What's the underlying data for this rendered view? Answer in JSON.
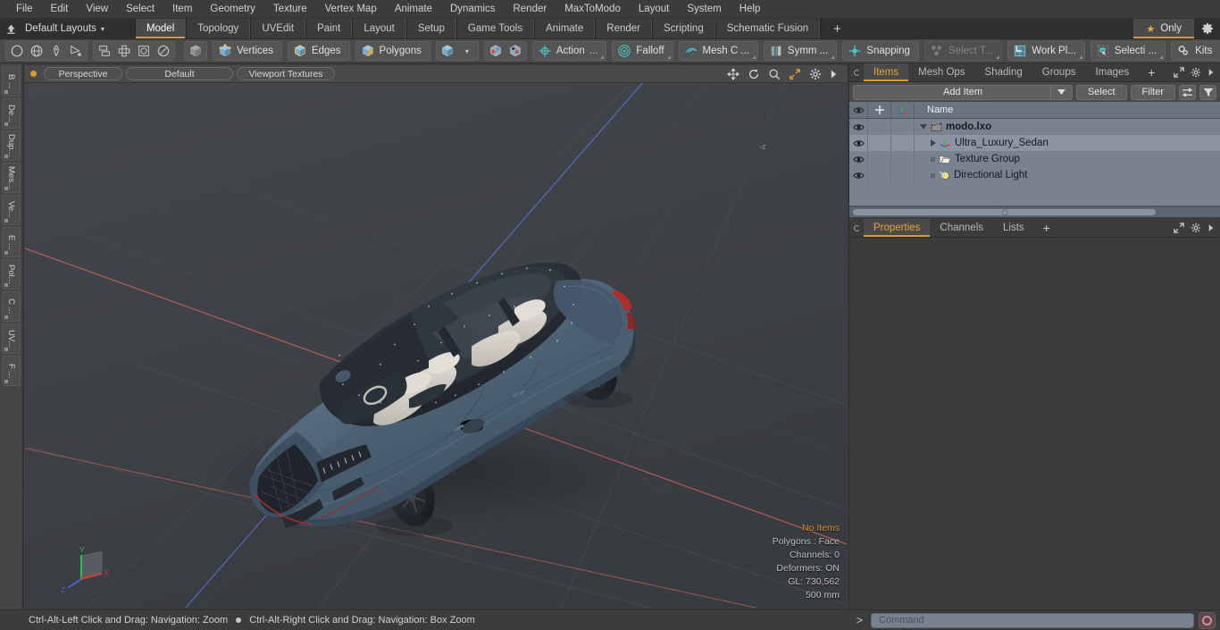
{
  "menubar": {
    "items": [
      "File",
      "Edit",
      "View",
      "Select",
      "Item",
      "Geometry",
      "Texture",
      "Vertex Map",
      "Animate",
      "Dynamics",
      "Render",
      "MaxToModo",
      "Layout",
      "System",
      "Help"
    ]
  },
  "layoutbar": {
    "home_icon": "home-arrow-icon",
    "layouts_label": "Default Layouts",
    "caret": "▾",
    "tabs": [
      "Model",
      "Topology",
      "UVEdit",
      "Paint",
      "Layout",
      "Setup",
      "Game Tools",
      "Animate",
      "Render",
      "Scripting",
      "Schematic Fusion"
    ],
    "active_tab": "Model",
    "add_tab_label": "+",
    "only_label": "Only",
    "star_glyph": "★",
    "gear_icon": "gear-icon",
    "accent_color": "#d79a35"
  },
  "toolbar": {
    "shape_tools": [
      "circle-icon",
      "globe-icon",
      "pen-icon",
      "curve-icon"
    ],
    "mesh_tools": [
      "stack-icon",
      "array-icon",
      "boolean-icon",
      "shell-icon"
    ],
    "mode_cube": "cube-icon",
    "selection_modes": [
      {
        "label": "Vertices",
        "icon": "vertices-cube-icon"
      },
      {
        "label": "Edges",
        "icon": "edges-cube-icon"
      },
      {
        "label": "Polygons",
        "icon": "polygons-cube-icon"
      }
    ],
    "item_mode_icon": "item-cube-icon",
    "item_mode_caret": "▾",
    "center_icons": [
      "center-pivot-icon",
      "center-axis-icon"
    ],
    "action_label": "Action",
    "action_ellipsis": "...",
    "falloff_label": "Falloff",
    "mesh_constraint_label": "Mesh C ...",
    "symmetry_label": "Symm ...",
    "snapping_label": "Snapping",
    "select_through_label": "Select T...",
    "work_plane_label": "Work Pl...",
    "selection_sets_label": "Selecti ...",
    "kits_label": "Kits",
    "app_icons": [
      "modo-cube-icon",
      "unreal-icon"
    ]
  },
  "leftrail": {
    "items": [
      "B ...",
      "De...",
      "Dup...",
      "Mes...",
      "Ve...",
      "E ...",
      "Pol...",
      "C ...",
      "UV...",
      "F ..."
    ]
  },
  "viewport": {
    "header": {
      "dot_color": "#d79a35",
      "pills": [
        "Perspective",
        "Default",
        "Viewport Textures"
      ],
      "tool_icons": [
        "move-icon",
        "rotate-icon",
        "zoom-icon",
        "fit-icon",
        "gear-icon",
        "chevron-right-icon"
      ]
    },
    "stats": {
      "no_items": "No Items",
      "polygons": "Polygons : Face",
      "channels": "Channels: 0",
      "deformers": "Deformers: ON",
      "gl": "GL: 730,562",
      "grid": "500 mm"
    },
    "axis_gizmo": {
      "x_label": "X",
      "y_label": "Y",
      "z_label": "Z",
      "x_color": "#cc4444",
      "y_color": "#44bb44",
      "z_color": "#4466dd"
    },
    "background_color": "#3e4146",
    "model": {
      "name": "Ultra Luxury Sedan",
      "body_color": "#4d6375",
      "interior_color": "#d8d5cd",
      "glass_color": "#2b3038"
    },
    "z_label": "-z"
  },
  "statusbar": {
    "hint_left": "Ctrl-Alt-Left Click and Drag: Navigation: Zoom",
    "hint_right": "Ctrl-Alt-Right Click and Drag: Navigation: Box Zoom"
  },
  "rightpanel": {
    "top_tabs": [
      "Items",
      "Mesh Ops",
      "Shading",
      "Groups",
      "Images"
    ],
    "top_active": "Items",
    "top_plus": "+",
    "top_right_icons": [
      "expand-icon",
      "gear-icon",
      "chevron-right-icon"
    ],
    "items_toolbar": {
      "add_item_label": "Add Item",
      "dropdown_caret": "▾",
      "select_label": "Select",
      "filter_label": "Filter",
      "list_options_icon": "list-options-icon",
      "funnel_icon": "funnel-icon"
    },
    "tree_header": {
      "eye_icon": "eye-icon",
      "lock_icon": "move-lock-icon",
      "axis_icon": "axis-icon",
      "name_label": "Name"
    },
    "tree_rows": [
      {
        "label": "modo.lxo",
        "icon": "scene-clapper-icon",
        "depth": 0,
        "expander": "down",
        "bold": true,
        "selected": false
      },
      {
        "label": "Ultra_Luxury_Sedan",
        "icon": "mesh-axis-icon",
        "depth": 1,
        "expander": "right",
        "bold": false,
        "selected": true
      },
      {
        "label": "Texture Group",
        "icon": "folder-icon",
        "depth": 1,
        "expander": "none",
        "bold": false,
        "selected": false
      },
      {
        "label": "Directional Light",
        "icon": "light-icon",
        "depth": 1,
        "expander": "none",
        "bold": false,
        "selected": false
      }
    ],
    "bottom_tabs": [
      "Properties",
      "Channels",
      "Lists"
    ],
    "bottom_active": "Properties",
    "bottom_plus": "+",
    "bottom_right_icons": [
      "expand-icon",
      "gear-icon",
      "chevron-right-icon"
    ]
  },
  "commandbar": {
    "prompt": "&gt;",
    "placeholder": "Command",
    "run_icon": "record-icon"
  }
}
